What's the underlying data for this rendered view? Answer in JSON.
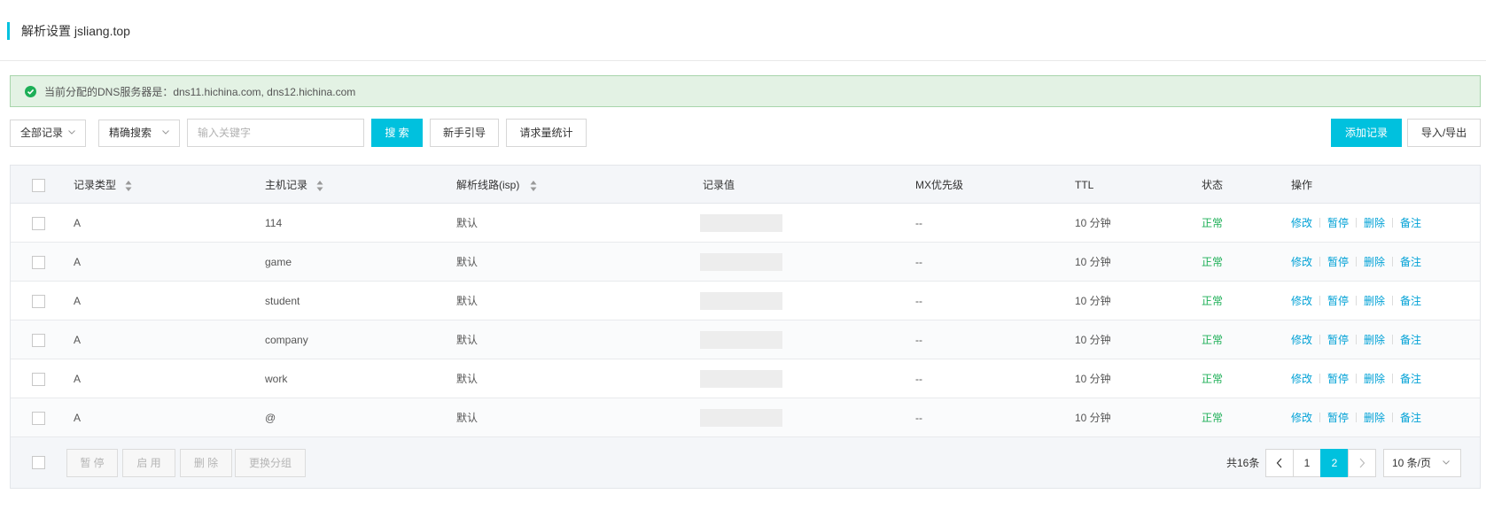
{
  "header": {
    "title": "解析设置 jsliang.top"
  },
  "dns_notice": {
    "text": "当前分配的DNS服务器是：dns11.hichina.com, dns12.hichina.com",
    "icon": "check-circle-icon"
  },
  "toolbar": {
    "record_filter": "全部记录",
    "search_mode": "精确搜索",
    "search_placeholder": "输入关键字",
    "search_button": "搜 索",
    "guide_button": "新手引导",
    "stats_button": "请求量统计",
    "add_button": "添加记录",
    "import_export_button": "导入/导出"
  },
  "table": {
    "headers": {
      "type": "记录类型",
      "host": "主机记录",
      "line": "解析线路(isp)",
      "value": "记录值",
      "mx": "MX优先级",
      "ttl": "TTL",
      "status": "状态",
      "ops": "操作"
    },
    "ops_labels": {
      "edit": "修改",
      "pause": "暂停",
      "delete": "删除",
      "note": "备注"
    },
    "rows": [
      {
        "type": "A",
        "host": "114",
        "line": "默认",
        "mx": "--",
        "ttl": "10 分钟",
        "status": "正常"
      },
      {
        "type": "A",
        "host": "game",
        "line": "默认",
        "mx": "--",
        "ttl": "10 分钟",
        "status": "正常"
      },
      {
        "type": "A",
        "host": "student",
        "line": "默认",
        "mx": "--",
        "ttl": "10 分钟",
        "status": "正常"
      },
      {
        "type": "A",
        "host": "company",
        "line": "默认",
        "mx": "--",
        "ttl": "10 分钟",
        "status": "正常"
      },
      {
        "type": "A",
        "host": "work",
        "line": "默认",
        "mx": "--",
        "ttl": "10 分钟",
        "status": "正常"
      },
      {
        "type": "A",
        "host": "@",
        "line": "默认",
        "mx": "--",
        "ttl": "10 分钟",
        "status": "正常"
      }
    ]
  },
  "footer": {
    "batch_pause": "暂 停",
    "batch_enable": "启 用",
    "batch_delete": "删 除",
    "batch_group": "更换分组",
    "total": "共16条",
    "pages": [
      "1",
      "2"
    ],
    "current_page": "2",
    "page_size": "10 条/页"
  },
  "colors": {
    "accent": "#00c1de",
    "success": "#1daf57",
    "link": "#00a1d6"
  }
}
